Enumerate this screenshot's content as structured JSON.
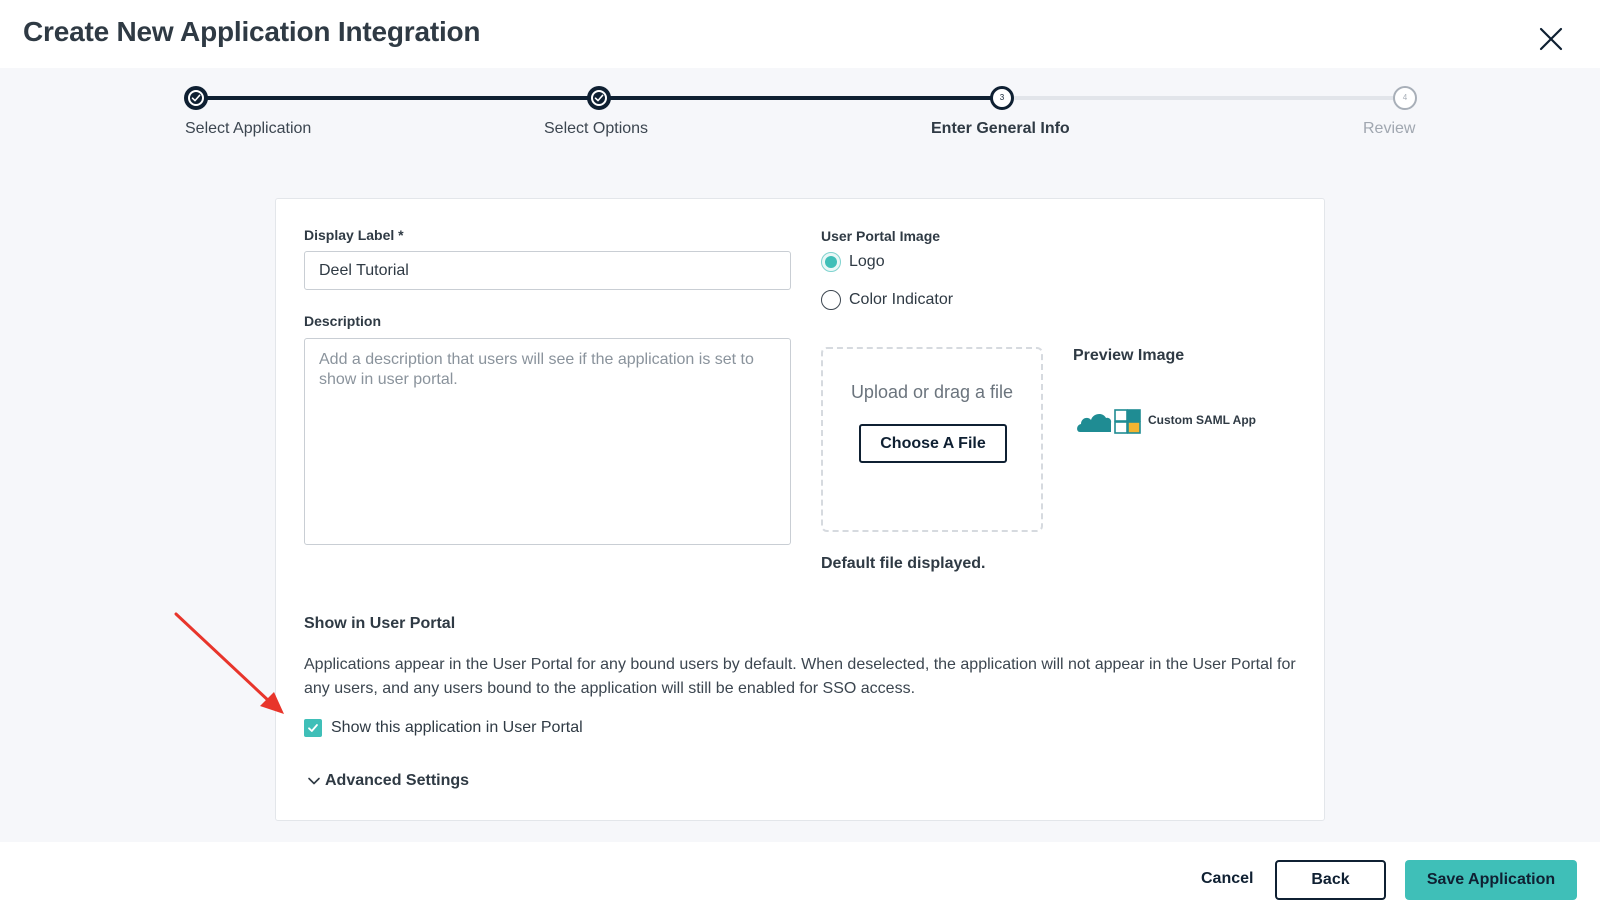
{
  "header": {
    "title": "Create New Application Integration"
  },
  "stepper": {
    "steps": [
      {
        "label": "Select Application",
        "state": "done"
      },
      {
        "label": "Select Options",
        "state": "done"
      },
      {
        "label": "Enter General Info",
        "state": "current",
        "number": "3"
      },
      {
        "label": "Review",
        "state": "future",
        "number": "4"
      }
    ]
  },
  "form": {
    "display_label": {
      "label": "Display Label *",
      "value": "Deel Tutorial"
    },
    "description": {
      "label": "Description",
      "placeholder": "Add a description that users will see if the application is set to show in user portal.",
      "value": ""
    },
    "user_portal_image": {
      "label": "User Portal Image",
      "options": [
        {
          "label": "Logo",
          "selected": true
        },
        {
          "label": "Color Indicator",
          "selected": false
        }
      ]
    },
    "upload": {
      "text": "Upload or drag a file",
      "button_label": "Choose A File",
      "default_note": "Default file displayed."
    },
    "preview": {
      "title": "Preview Image",
      "logo_text": "Custom SAML App"
    },
    "show_in_portal": {
      "title": "Show in User Portal",
      "description": "Applications appear in the User Portal for any bound users by default. When deselected, the application will not appear in the User Portal for any users, and any users bound to the application will still be enabled for SSO access.",
      "checkbox_label": "Show this application in User Portal",
      "checked": true
    },
    "advanced_label": "Advanced Settings"
  },
  "footer": {
    "cancel_label": "Cancel",
    "back_label": "Back",
    "save_label": "Save Application"
  },
  "colors": {
    "accent": "#3fbfb8",
    "navy": "#0f2032",
    "annotation_arrow": "#e8352b"
  }
}
